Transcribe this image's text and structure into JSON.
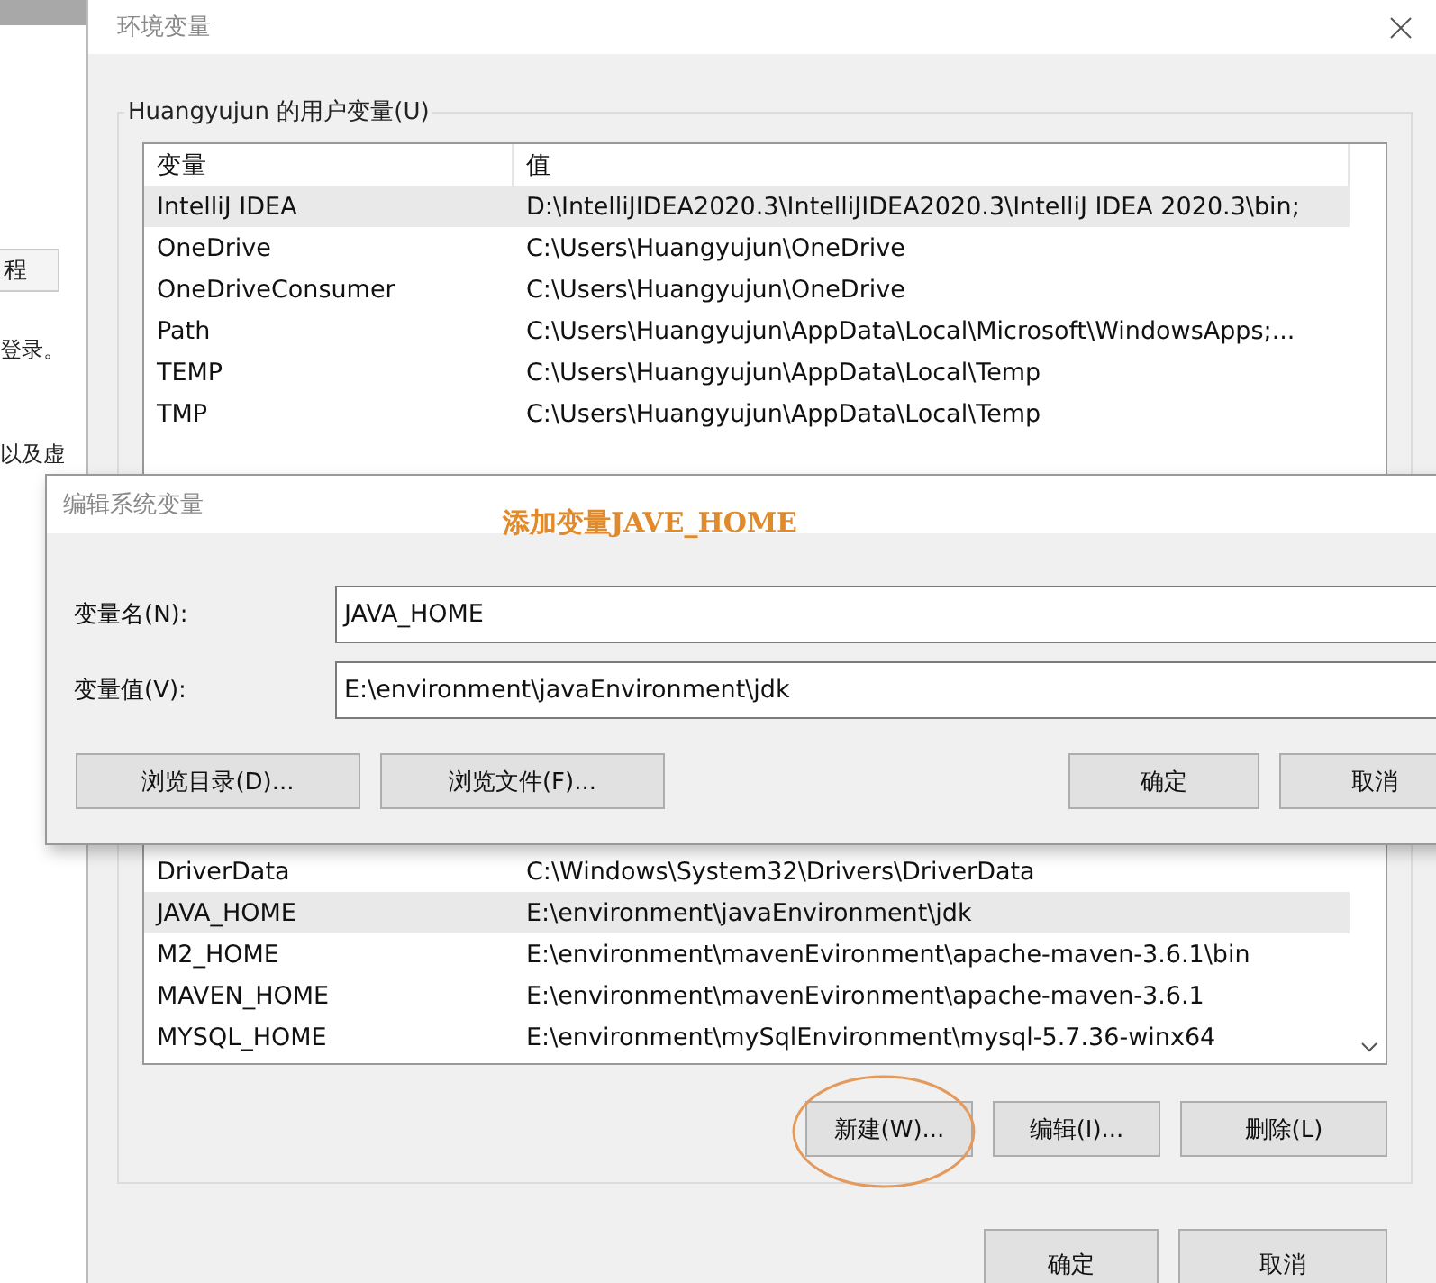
{
  "background_window": {
    "tab": "程",
    "texts": [
      "登录。",
      "以及虚"
    ]
  },
  "window": {
    "title": "环境变量"
  },
  "user_variables": {
    "label": "Huangyujun 的用户变量(U)",
    "columns": [
      "变量",
      "值"
    ],
    "rows": [
      {
        "name": "IntelliJ IDEA",
        "value": "D:\\IntelliJIDEA2020.3\\IntelliJIDEA2020.3\\IntelliJ IDEA 2020.3\\bin;",
        "selected": true
      },
      {
        "name": "OneDrive",
        "value": "C:\\Users\\Huangyujun\\OneDrive",
        "selected": false
      },
      {
        "name": "OneDriveConsumer",
        "value": "C:\\Users\\Huangyujun\\OneDrive",
        "selected": false
      },
      {
        "name": "Path",
        "value": "C:\\Users\\Huangyujun\\AppData\\Local\\Microsoft\\WindowsApps;...",
        "selected": false
      },
      {
        "name": "TEMP",
        "value": "C:\\Users\\Huangyujun\\AppData\\Local\\Temp",
        "selected": false
      },
      {
        "name": "TMP",
        "value": "C:\\Users\\Huangyujun\\AppData\\Local\\Temp",
        "selected": false
      }
    ]
  },
  "system_variables": {
    "rows": [
      {
        "name": "DriverData",
        "value": "C:\\Windows\\System32\\Drivers\\DriverData",
        "selected": false
      },
      {
        "name": "JAVA_HOME",
        "value": "E:\\environment\\javaEnvironment\\jdk",
        "selected": true
      },
      {
        "name": "M2_HOME",
        "value": "E:\\environment\\mavenEvironment\\apache-maven-3.6.1\\bin",
        "selected": false
      },
      {
        "name": "MAVEN_HOME",
        "value": "E:\\environment\\mavenEvironment\\apache-maven-3.6.1",
        "selected": false
      },
      {
        "name": "MYSQL_HOME",
        "value": "E:\\environment\\mySqlEnvironment\\mysql-5.7.36-winx64",
        "selected": false
      }
    ],
    "buttons": [
      {
        "label": "新建(W)...",
        "circled": true
      },
      {
        "label": "编辑(I)...",
        "circled": false
      },
      {
        "label": "删除(L)",
        "circled": false
      }
    ]
  },
  "dialog_buttons": [
    "确定",
    "取消"
  ],
  "edit_dialog": {
    "title": "编辑系统变量",
    "annotation": "添加变量JAVE_HOME",
    "fields": [
      {
        "label": "变量名(N):",
        "value": "JAVA_HOME"
      },
      {
        "label": "变量值(V):",
        "value": "E:\\environment\\javaEnvironment\\jdk"
      }
    ],
    "buttons": [
      "浏览目录(D)...",
      "浏览文件(F)...",
      "确定",
      "取消"
    ]
  }
}
